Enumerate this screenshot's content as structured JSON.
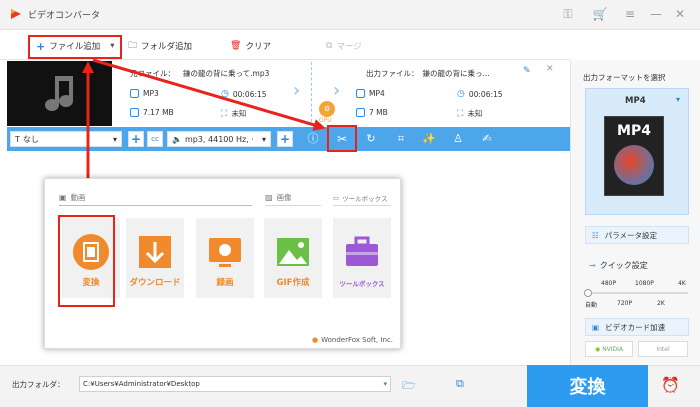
{
  "window": {
    "title": "ビデオコンバータ"
  },
  "toolbar": {
    "add_file": "ファイル追加",
    "add_folder": "フォルダ追加",
    "clear": "クリア",
    "merge": "マージ"
  },
  "file": {
    "source_label": "元ファイル：",
    "source_name": "鎌の龍の背に乗って.mp3",
    "format": "MP3",
    "duration": "00:06:15",
    "size": "7.17 MB",
    "resolution": "未知",
    "output_label": "出力ファイル：",
    "output_name": "鎌の龍の背に乗っ...",
    "out_format": "MP4",
    "out_duration": "00:06:15",
    "out_size": "7 MB",
    "out_resolution": "未知",
    "gpu_label": "GPU"
  },
  "tools": {
    "subtitle": "なし",
    "audio": "mp3, 44100 Hz, ·"
  },
  "popup": {
    "sections": {
      "video": "動画",
      "image": "画像",
      "toolbox": "ツールボックス"
    },
    "cards": [
      {
        "label": "変換",
        "color": "#f08a2c"
      },
      {
        "label": "ダウンロード",
        "color": "#f08a2c"
      },
      {
        "label": "録画",
        "color": "#f08a2c"
      },
      {
        "label": "GIF作成",
        "color": "#f08a2c"
      },
      {
        "label": "ツールボックス",
        "color": "#9b59d6"
      }
    ],
    "footer": "WonderFox Soft, Inc."
  },
  "right": {
    "format_title": "出力フォーマットを選択",
    "format": "MP4",
    "format_thumb": "MP4",
    "param_settings": "パラメータ設定",
    "quick_settings": "クイック設定",
    "res_top": [
      "480P",
      "1080P",
      "4K"
    ],
    "res_bottom": [
      "自動",
      "720P",
      "2K"
    ],
    "hw_accel": "ビデオカード加速",
    "nvidia": "NVIDIA",
    "intel": "Intel"
  },
  "bottom": {
    "output_folder_label": "出力フォルダ：",
    "output_path": "C:¥Users¥Administrator¥Desktop",
    "convert": "変換"
  },
  "colors": {
    "accent": "#2d9cf0",
    "highlight": "#e8231a",
    "orange": "#f08a2c",
    "purple": "#9b59d6"
  }
}
